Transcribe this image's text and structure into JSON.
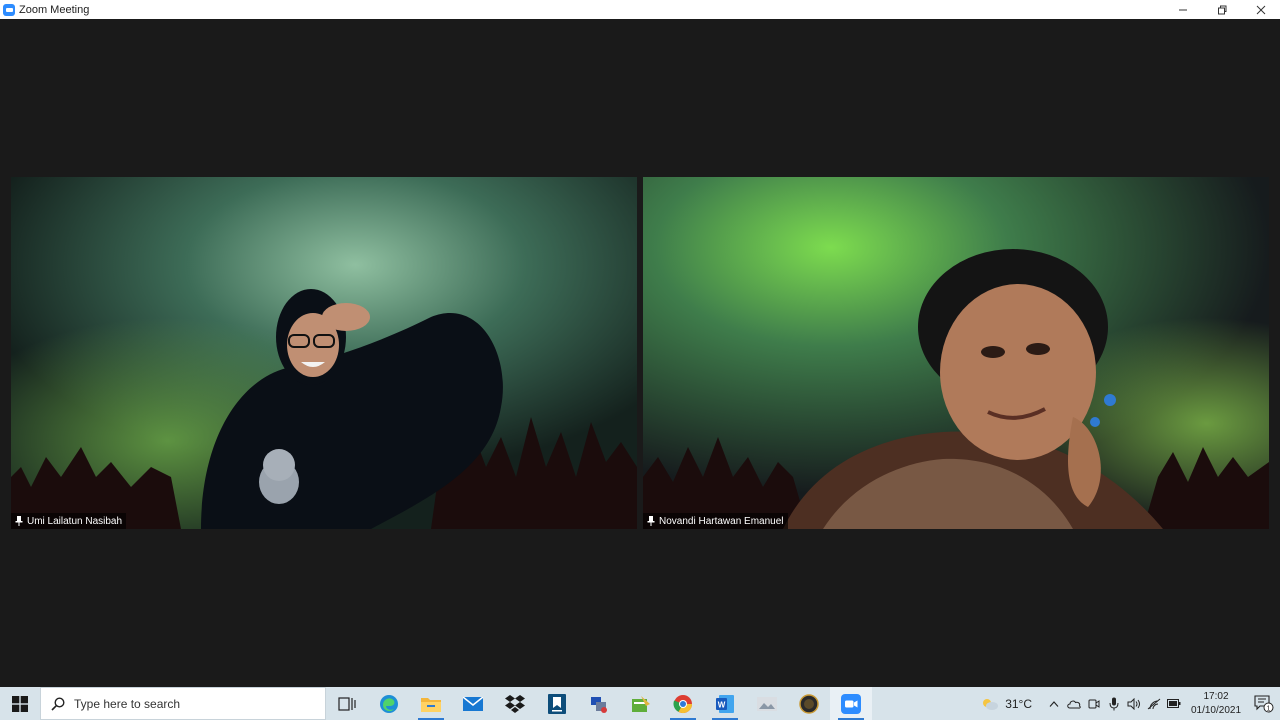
{
  "window": {
    "title": "Zoom Meeting"
  },
  "participants": [
    {
      "name": "Umi Lailatun Nasibah"
    },
    {
      "name": "Novandi Hartawan Emanuel"
    }
  ],
  "taskbar": {
    "search_placeholder": "Type here to search",
    "apps": [
      {
        "icon": "task-view-icon"
      },
      {
        "icon": "edge-icon"
      },
      {
        "icon": "file-explorer-icon"
      },
      {
        "icon": "mail-icon"
      },
      {
        "icon": "dropbox-icon"
      },
      {
        "icon": "kindle-icon"
      },
      {
        "icon": "network-app-icon"
      },
      {
        "icon": "spreadsheet-tool-icon"
      },
      {
        "icon": "chrome-icon"
      },
      {
        "icon": "word-icon"
      },
      {
        "icon": "image-viewer-icon"
      },
      {
        "icon": "circular-app-icon"
      },
      {
        "icon": "zoom-icon"
      }
    ],
    "weather": "31°C",
    "time": "17:02",
    "date": "01/10/2021",
    "notification_count": "1"
  },
  "colors": {
    "zoom_blue": "#2D8CFF",
    "meeting_bg": "#1a1a1a",
    "taskbar_bg": "#d7e3ea"
  }
}
